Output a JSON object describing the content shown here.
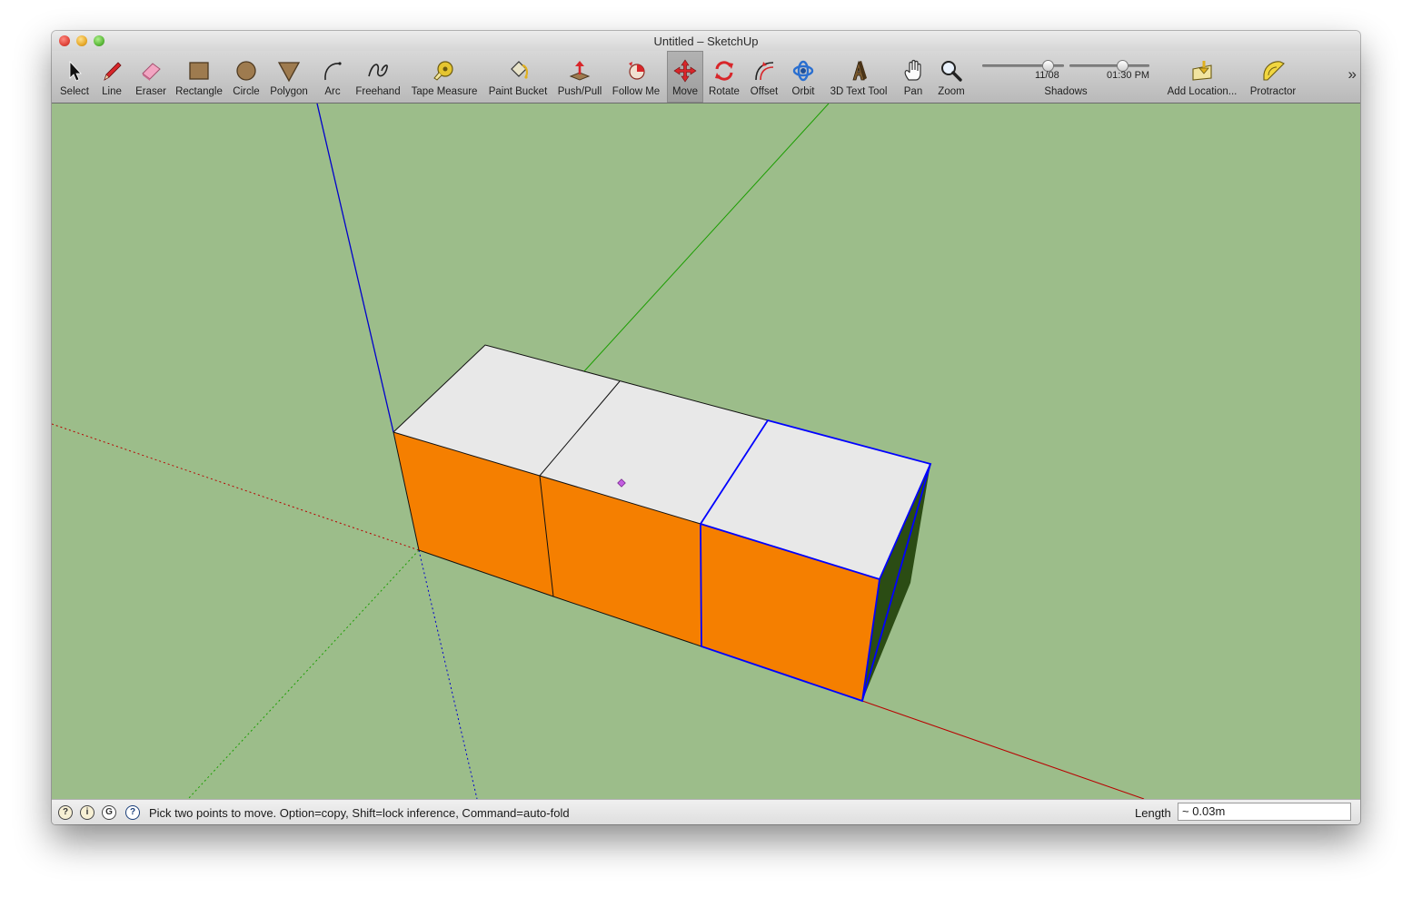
{
  "window": {
    "title": "Untitled – SketchUp"
  },
  "toolbar": {
    "tools": [
      {
        "name": "select",
        "label": "Select",
        "icon": "arrow-cursor-icon"
      },
      {
        "name": "line",
        "label": "Line",
        "icon": "pencil-icon"
      },
      {
        "name": "eraser",
        "label": "Eraser",
        "icon": "eraser-icon"
      },
      {
        "name": "rectangle",
        "label": "Rectangle",
        "icon": "rectangle-icon"
      },
      {
        "name": "circle",
        "label": "Circle",
        "icon": "circle-icon"
      },
      {
        "name": "polygon",
        "label": "Polygon",
        "icon": "polygon-icon"
      },
      {
        "name": "arc",
        "label": "Arc",
        "icon": "arc-icon"
      },
      {
        "name": "freehand",
        "label": "Freehand",
        "icon": "freehand-icon"
      },
      {
        "name": "tape-measure",
        "label": "Tape Measure",
        "icon": "tape-measure-icon"
      },
      {
        "name": "paint-bucket",
        "label": "Paint Bucket",
        "icon": "paint-bucket-icon"
      },
      {
        "name": "push-pull",
        "label": "Push/Pull",
        "icon": "push-pull-icon"
      },
      {
        "name": "follow-me",
        "label": "Follow Me",
        "icon": "follow-me-icon"
      },
      {
        "name": "move",
        "label": "Move",
        "icon": "move-icon",
        "active": true
      },
      {
        "name": "rotate",
        "label": "Rotate",
        "icon": "rotate-icon"
      },
      {
        "name": "offset",
        "label": "Offset",
        "icon": "offset-icon"
      },
      {
        "name": "orbit",
        "label": "Orbit",
        "icon": "orbit-icon"
      },
      {
        "name": "3d-text",
        "label": "3D Text Tool",
        "icon": "3d-text-icon"
      },
      {
        "name": "pan",
        "label": "Pan",
        "icon": "hand-icon"
      },
      {
        "name": "zoom",
        "label": "Zoom",
        "icon": "magnifier-icon"
      },
      {
        "name": "add-location",
        "label": "Add Location...",
        "icon": "add-location-icon"
      },
      {
        "name": "protractor",
        "label": "Protractor",
        "icon": "protractor-icon"
      }
    ],
    "shadows": {
      "label": "Shadows",
      "date": "11/08",
      "time": "01:30 PM"
    }
  },
  "status": {
    "message": "Pick two points to move.  Option=copy, Shift=lock inference, Command=auto-fold",
    "icons": [
      "geo-location-icon",
      "credits-icon",
      "google-sign-in-icon",
      "help-icon"
    ],
    "measurement_label": "Length",
    "measurement_value": "~ 0.03m"
  },
  "scene": {
    "colors": {
      "background": "#9cbd8a",
      "front_face": "#f57f00",
      "top_face": "#e8e8e8",
      "side_face": "#2b4c14",
      "selection": "#0000ff",
      "x_axis": "#b80000",
      "y_axis": "#1a9d00",
      "z_axis": "#0000cc",
      "cursor": "#c35de0"
    }
  }
}
